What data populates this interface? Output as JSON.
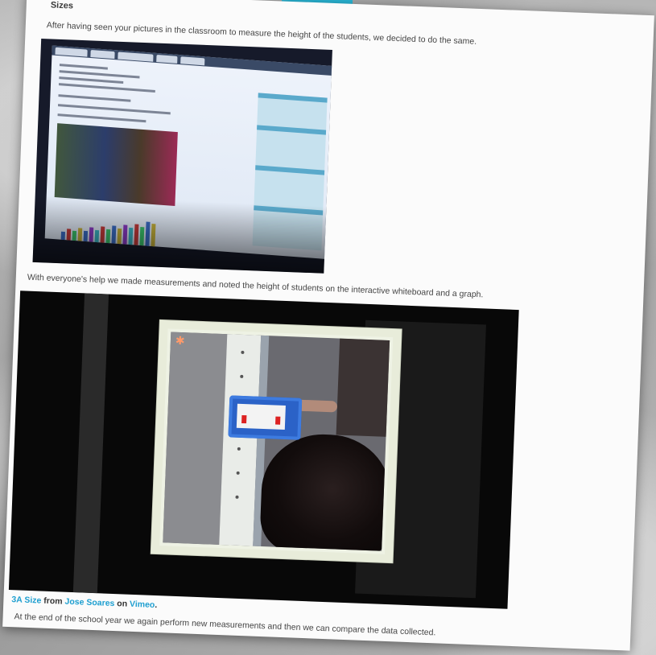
{
  "section": {
    "heading": "Sizes",
    "intro": "After having seen your pictures in the classroom to measure the height of the students, we decided to do the same.",
    "middle": "With everyone's help we made measurements and noted the height of students on the interactive whiteboard and a graph.",
    "closing": "At the end of the school year we again perform new measurements and then we can compare the data collected."
  },
  "video_credit": {
    "title": "3A Size",
    "from_label": "from",
    "author": "Jose Soares",
    "on_label": "on",
    "platform": "Vimeo",
    "trailing": "."
  },
  "colors": {
    "accent": "#29b6d6",
    "link": "#1e9fd0",
    "page_bg": "#fbfbfb"
  }
}
